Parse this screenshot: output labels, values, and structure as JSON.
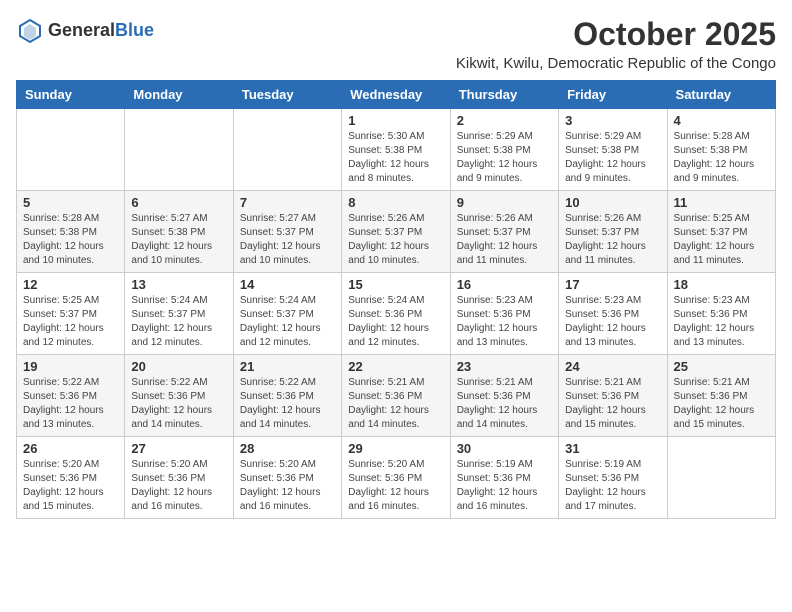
{
  "header": {
    "logo_general": "General",
    "logo_blue": "Blue",
    "month_year": "October 2025",
    "location": "Kikwit, Kwilu, Democratic Republic of the Congo"
  },
  "weekdays": [
    "Sunday",
    "Monday",
    "Tuesday",
    "Wednesday",
    "Thursday",
    "Friday",
    "Saturday"
  ],
  "weeks": [
    [
      {
        "day": "",
        "info": ""
      },
      {
        "day": "",
        "info": ""
      },
      {
        "day": "",
        "info": ""
      },
      {
        "day": "1",
        "info": "Sunrise: 5:30 AM\nSunset: 5:38 PM\nDaylight: 12 hours\nand 8 minutes."
      },
      {
        "day": "2",
        "info": "Sunrise: 5:29 AM\nSunset: 5:38 PM\nDaylight: 12 hours\nand 9 minutes."
      },
      {
        "day": "3",
        "info": "Sunrise: 5:29 AM\nSunset: 5:38 PM\nDaylight: 12 hours\nand 9 minutes."
      },
      {
        "day": "4",
        "info": "Sunrise: 5:28 AM\nSunset: 5:38 PM\nDaylight: 12 hours\nand 9 minutes."
      }
    ],
    [
      {
        "day": "5",
        "info": "Sunrise: 5:28 AM\nSunset: 5:38 PM\nDaylight: 12 hours\nand 10 minutes."
      },
      {
        "day": "6",
        "info": "Sunrise: 5:27 AM\nSunset: 5:38 PM\nDaylight: 12 hours\nand 10 minutes."
      },
      {
        "day": "7",
        "info": "Sunrise: 5:27 AM\nSunset: 5:37 PM\nDaylight: 12 hours\nand 10 minutes."
      },
      {
        "day": "8",
        "info": "Sunrise: 5:26 AM\nSunset: 5:37 PM\nDaylight: 12 hours\nand 10 minutes."
      },
      {
        "day": "9",
        "info": "Sunrise: 5:26 AM\nSunset: 5:37 PM\nDaylight: 12 hours\nand 11 minutes."
      },
      {
        "day": "10",
        "info": "Sunrise: 5:26 AM\nSunset: 5:37 PM\nDaylight: 12 hours\nand 11 minutes."
      },
      {
        "day": "11",
        "info": "Sunrise: 5:25 AM\nSunset: 5:37 PM\nDaylight: 12 hours\nand 11 minutes."
      }
    ],
    [
      {
        "day": "12",
        "info": "Sunrise: 5:25 AM\nSunset: 5:37 PM\nDaylight: 12 hours\nand 12 minutes."
      },
      {
        "day": "13",
        "info": "Sunrise: 5:24 AM\nSunset: 5:37 PM\nDaylight: 12 hours\nand 12 minutes."
      },
      {
        "day": "14",
        "info": "Sunrise: 5:24 AM\nSunset: 5:37 PM\nDaylight: 12 hours\nand 12 minutes."
      },
      {
        "day": "15",
        "info": "Sunrise: 5:24 AM\nSunset: 5:36 PM\nDaylight: 12 hours\nand 12 minutes."
      },
      {
        "day": "16",
        "info": "Sunrise: 5:23 AM\nSunset: 5:36 PM\nDaylight: 12 hours\nand 13 minutes."
      },
      {
        "day": "17",
        "info": "Sunrise: 5:23 AM\nSunset: 5:36 PM\nDaylight: 12 hours\nand 13 minutes."
      },
      {
        "day": "18",
        "info": "Sunrise: 5:23 AM\nSunset: 5:36 PM\nDaylight: 12 hours\nand 13 minutes."
      }
    ],
    [
      {
        "day": "19",
        "info": "Sunrise: 5:22 AM\nSunset: 5:36 PM\nDaylight: 12 hours\nand 13 minutes."
      },
      {
        "day": "20",
        "info": "Sunrise: 5:22 AM\nSunset: 5:36 PM\nDaylight: 12 hours\nand 14 minutes."
      },
      {
        "day": "21",
        "info": "Sunrise: 5:22 AM\nSunset: 5:36 PM\nDaylight: 12 hours\nand 14 minutes."
      },
      {
        "day": "22",
        "info": "Sunrise: 5:21 AM\nSunset: 5:36 PM\nDaylight: 12 hours\nand 14 minutes."
      },
      {
        "day": "23",
        "info": "Sunrise: 5:21 AM\nSunset: 5:36 PM\nDaylight: 12 hours\nand 14 minutes."
      },
      {
        "day": "24",
        "info": "Sunrise: 5:21 AM\nSunset: 5:36 PM\nDaylight: 12 hours\nand 15 minutes."
      },
      {
        "day": "25",
        "info": "Sunrise: 5:21 AM\nSunset: 5:36 PM\nDaylight: 12 hours\nand 15 minutes."
      }
    ],
    [
      {
        "day": "26",
        "info": "Sunrise: 5:20 AM\nSunset: 5:36 PM\nDaylight: 12 hours\nand 15 minutes."
      },
      {
        "day": "27",
        "info": "Sunrise: 5:20 AM\nSunset: 5:36 PM\nDaylight: 12 hours\nand 16 minutes."
      },
      {
        "day": "28",
        "info": "Sunrise: 5:20 AM\nSunset: 5:36 PM\nDaylight: 12 hours\nand 16 minutes."
      },
      {
        "day": "29",
        "info": "Sunrise: 5:20 AM\nSunset: 5:36 PM\nDaylight: 12 hours\nand 16 minutes."
      },
      {
        "day": "30",
        "info": "Sunrise: 5:19 AM\nSunset: 5:36 PM\nDaylight: 12 hours\nand 16 minutes."
      },
      {
        "day": "31",
        "info": "Sunrise: 5:19 AM\nSunset: 5:36 PM\nDaylight: 12 hours\nand 17 minutes."
      },
      {
        "day": "",
        "info": ""
      }
    ]
  ]
}
